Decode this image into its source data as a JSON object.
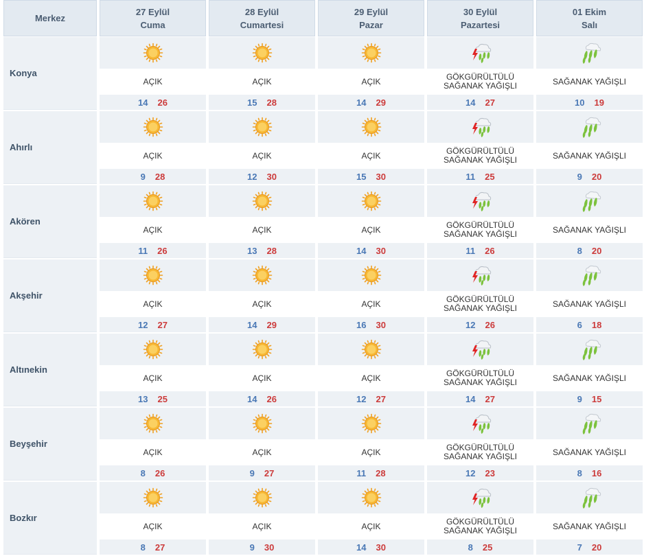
{
  "header": {
    "region_label": "Merkez",
    "days": [
      {
        "date": "27 Eylül",
        "weekday": "Cuma"
      },
      {
        "date": "28 Eylül",
        "weekday": "Cumartesi"
      },
      {
        "date": "29 Eylül",
        "weekday": "Pazar"
      },
      {
        "date": "30 Eylül",
        "weekday": "Pazartesi"
      },
      {
        "date": "01 Ekim",
        "weekday": "Salı"
      }
    ]
  },
  "conditions": {
    "clear": {
      "line1": "AÇIK",
      "line2": "",
      "icon": "sun-icon"
    },
    "thunder": {
      "line1": "GÖKGÜRÜLTÜLÜ",
      "line2": "SAĞANAK YAĞIŞLI",
      "icon": "thunder-shower-icon"
    },
    "shower": {
      "line1": "SAĞANAK YAĞIŞLI",
      "line2": "",
      "icon": "shower-icon"
    }
  },
  "colors": {
    "sun": "#f5a623",
    "rain_drop": "#7bbf3a",
    "lightning": "#e02424",
    "min_temp": "#4a78b5",
    "max_temp": "#cc3b3b"
  },
  "cities": [
    {
      "name": "Konya",
      "days": [
        {
          "cond": "clear",
          "min": "14",
          "max": "26"
        },
        {
          "cond": "clear",
          "min": "15",
          "max": "28"
        },
        {
          "cond": "clear",
          "min": "14",
          "max": "29"
        },
        {
          "cond": "thunder",
          "min": "14",
          "max": "27"
        },
        {
          "cond": "shower",
          "min": "10",
          "max": "19"
        }
      ]
    },
    {
      "name": "Ahırlı",
      "days": [
        {
          "cond": "clear",
          "min": "9",
          "max": "28"
        },
        {
          "cond": "clear",
          "min": "12",
          "max": "30"
        },
        {
          "cond": "clear",
          "min": "15",
          "max": "30"
        },
        {
          "cond": "thunder",
          "min": "11",
          "max": "25"
        },
        {
          "cond": "shower",
          "min": "9",
          "max": "20"
        }
      ]
    },
    {
      "name": "Akören",
      "days": [
        {
          "cond": "clear",
          "min": "11",
          "max": "26"
        },
        {
          "cond": "clear",
          "min": "13",
          "max": "28"
        },
        {
          "cond": "clear",
          "min": "14",
          "max": "30"
        },
        {
          "cond": "thunder",
          "min": "11",
          "max": "26"
        },
        {
          "cond": "shower",
          "min": "8",
          "max": "20"
        }
      ]
    },
    {
      "name": "Akşehir",
      "days": [
        {
          "cond": "clear",
          "min": "12",
          "max": "27"
        },
        {
          "cond": "clear",
          "min": "14",
          "max": "29"
        },
        {
          "cond": "clear",
          "min": "16",
          "max": "30"
        },
        {
          "cond": "thunder",
          "min": "12",
          "max": "26"
        },
        {
          "cond": "shower",
          "min": "6",
          "max": "18"
        }
      ]
    },
    {
      "name": "Altınekin",
      "days": [
        {
          "cond": "clear",
          "min": "13",
          "max": "25"
        },
        {
          "cond": "clear",
          "min": "14",
          "max": "26"
        },
        {
          "cond": "clear",
          "min": "12",
          "max": "27"
        },
        {
          "cond": "thunder",
          "min": "14",
          "max": "27"
        },
        {
          "cond": "shower",
          "min": "9",
          "max": "15"
        }
      ]
    },
    {
      "name": "Beyşehir",
      "days": [
        {
          "cond": "clear",
          "min": "8",
          "max": "26"
        },
        {
          "cond": "clear",
          "min": "9",
          "max": "27"
        },
        {
          "cond": "clear",
          "min": "11",
          "max": "28"
        },
        {
          "cond": "thunder",
          "min": "12",
          "max": "23"
        },
        {
          "cond": "shower",
          "min": "8",
          "max": "16"
        }
      ]
    },
    {
      "name": "Bozkır",
      "days": [
        {
          "cond": "clear",
          "min": "8",
          "max": "27"
        },
        {
          "cond": "clear",
          "min": "9",
          "max": "30"
        },
        {
          "cond": "clear",
          "min": "14",
          "max": "30"
        },
        {
          "cond": "thunder",
          "min": "8",
          "max": "25"
        },
        {
          "cond": "shower",
          "min": "7",
          "max": "20"
        }
      ]
    }
  ]
}
